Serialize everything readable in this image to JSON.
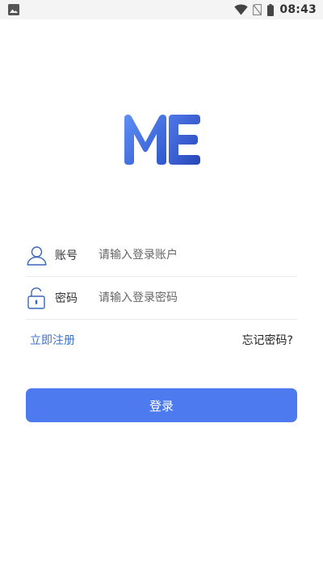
{
  "status_bar": {
    "time": "08:43",
    "icons": [
      "photo-icon",
      "wifi-icon",
      "no-sim-icon",
      "battery-icon"
    ]
  },
  "logo": {
    "text": "ME",
    "colors": [
      "#3d6ae6",
      "#2f4fbf"
    ]
  },
  "form": {
    "account": {
      "label": "账号",
      "placeholder": "请输入登录账户",
      "value": "",
      "icon": "user-icon"
    },
    "password": {
      "label": "密码",
      "placeholder": "请输入登录密码",
      "value": "",
      "icon": "unlock-icon"
    }
  },
  "links": {
    "register": "立即注册",
    "forgot": "忘记密码?"
  },
  "login_button": {
    "label": "登录"
  },
  "colors": {
    "primary": "#4d7bef",
    "link": "#3c72c8",
    "icon": "#3a66b8",
    "divider": "#ececec"
  }
}
